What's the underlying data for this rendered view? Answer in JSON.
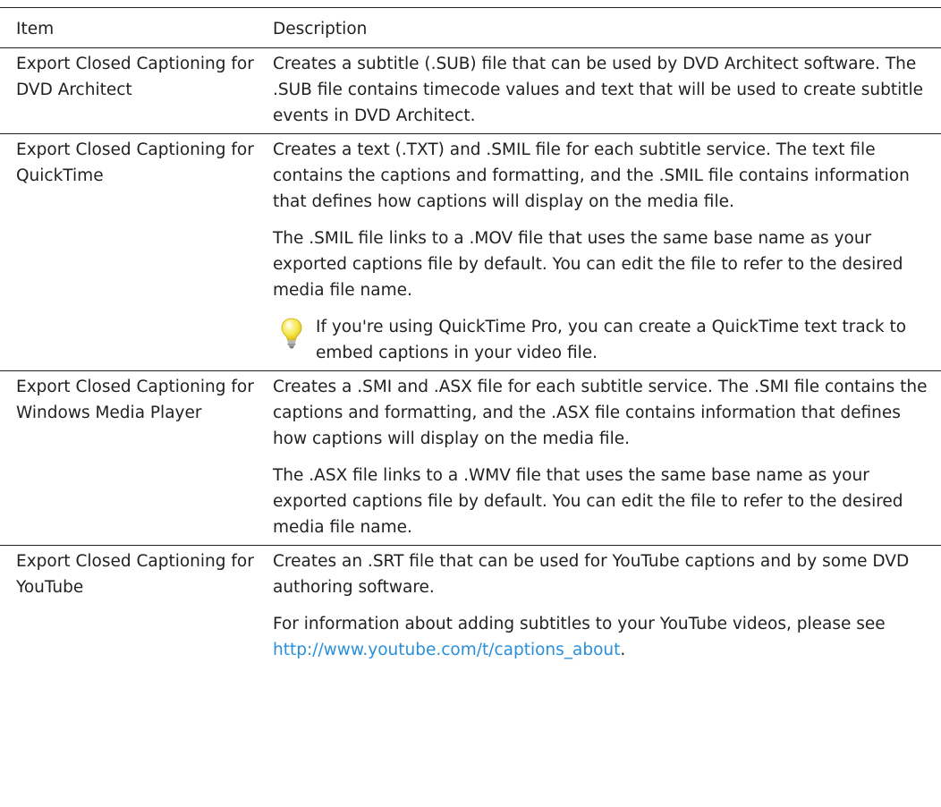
{
  "table": {
    "headers": {
      "item": "Item",
      "description": "Description"
    },
    "rows": [
      {
        "item": "Export Closed Captioning for DVD Architect",
        "p1": "Creates a subtitle (.SUB) file that can be used by DVD Architect software. The .SUB file contains timecode values and text that will be used to create subtitle events in DVD Architect."
      },
      {
        "item": "Export Closed Captioning for QuickTime",
        "p1": "Creates a text (.TXT) and .SMIL file for each subtitle service. The text file contains the captions and formatting, and the .SMIL file contains information that defines how captions will display on the media file.",
        "p2": "The .SMIL file links to a .MOV file that uses the same base name as your exported captions file by default. You can edit the file to refer to the desired media file name.",
        "tip": "If you're using QuickTime Pro, you can create a QuickTime text track to embed captions in your video file."
      },
      {
        "item": "Export Closed Captioning for Windows Media Player",
        "p1": "Creates a .SMI and .ASX file for each subtitle service. The .SMI file contains the captions and formatting, and the .ASX file contains information that defines how captions will display on the media file.",
        "p2": "The .ASX file links to a .WMV file that uses the same base name as your exported captions file by default. You can edit the file to refer to the desired media file name."
      },
      {
        "item": "Export Closed Captioning for YouTube",
        "p1": "Creates an .SRT file that can be used for YouTube captions and by some DVD authoring software.",
        "p2_prefix": "For information about adding subtitles to your YouTube videos, please see ",
        "p2_link": "http://www.youtube.com/t/captions_about",
        "p2_suffix": "."
      }
    ]
  },
  "icons": {
    "tip": "lightbulb-icon"
  },
  "colors": {
    "text": "#231f20",
    "link": "#2a8fd9",
    "rule": "#231f20",
    "bulb": "#f2e24a"
  }
}
